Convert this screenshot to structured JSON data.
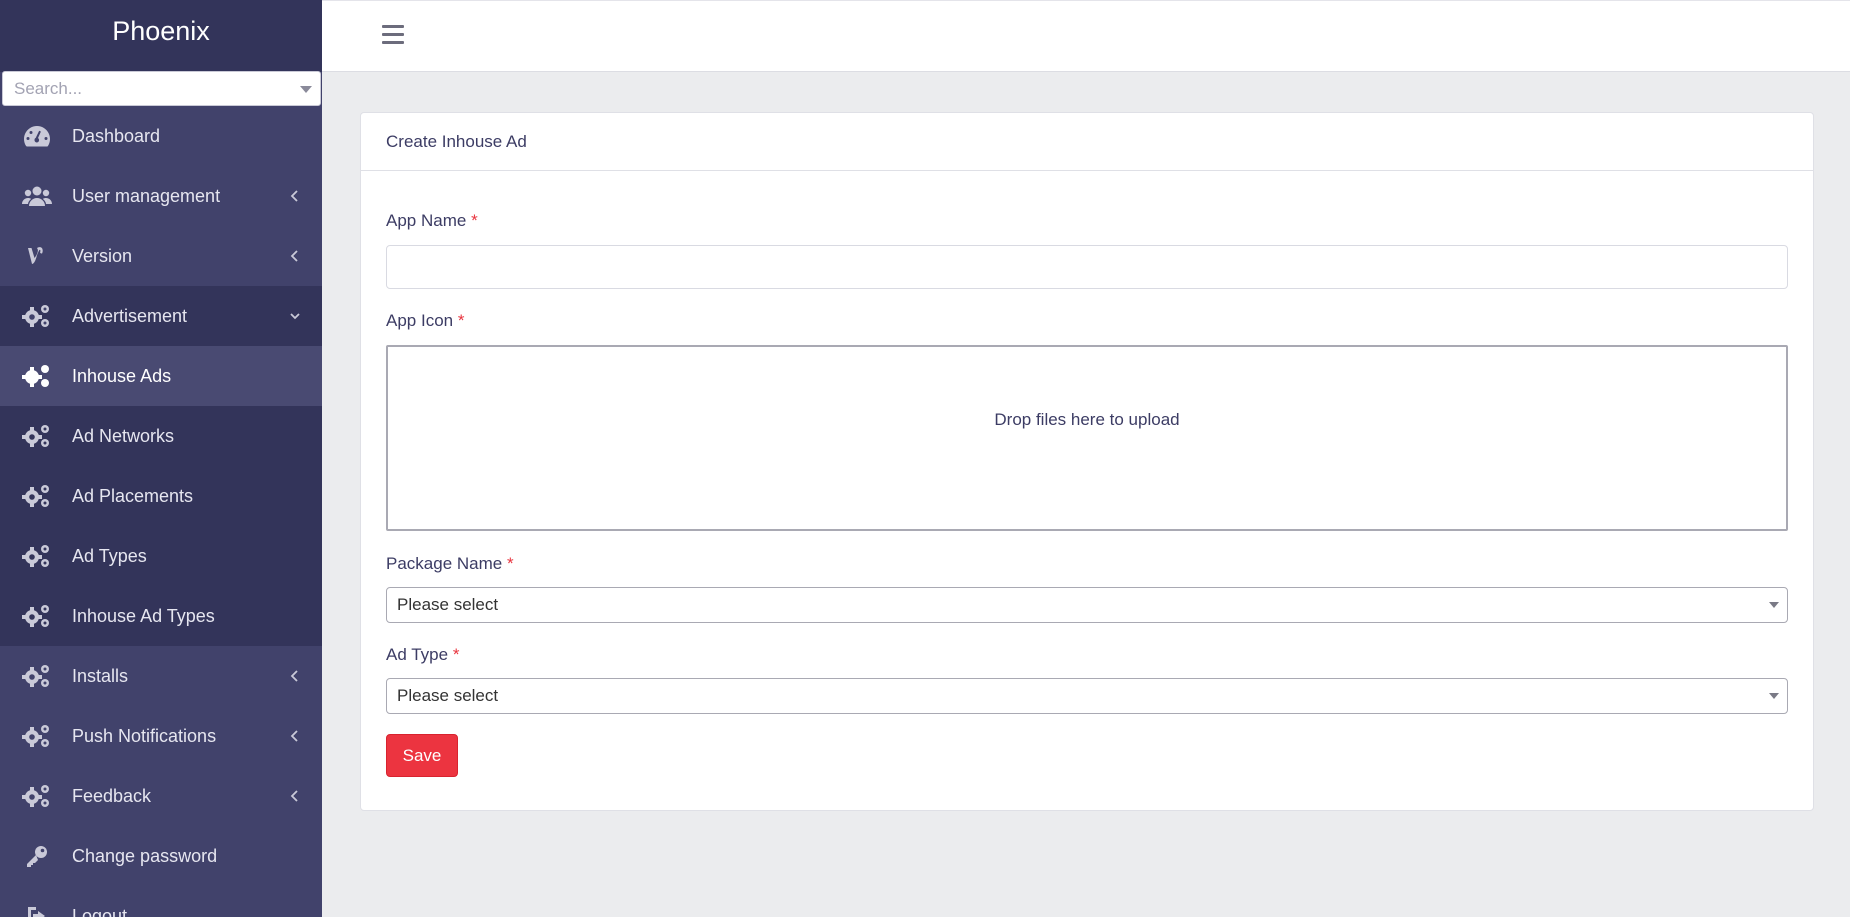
{
  "brand": {
    "title": "Phoenix"
  },
  "sidebar_search": {
    "placeholder": "Search..."
  },
  "menu": {
    "dashboard": "Dashboard",
    "user_management": "User management",
    "version": "Version",
    "advertisement": "Advertisement",
    "inhouse_ads": "Inhouse Ads",
    "ad_networks": "Ad Networks",
    "ad_placements": "Ad Placements",
    "ad_types": "Ad Types",
    "inhouse_ad_types": "Inhouse Ad Types",
    "installs": "Installs",
    "push_notifications": "Push Notifications",
    "feedback": "Feedback",
    "change_password": "Change password",
    "logout": "Logout"
  },
  "card": {
    "title": "Create Inhouse Ad"
  },
  "form": {
    "app_name_label": "App Name",
    "app_icon_label": "App Icon",
    "dropzone_text": "Drop files here to upload",
    "package_name_label": "Package Name",
    "package_name_value": "Please select",
    "ad_type_label": "Ad Type",
    "ad_type_value": "Please select",
    "required_mark": "*",
    "save_label": "Save"
  }
}
